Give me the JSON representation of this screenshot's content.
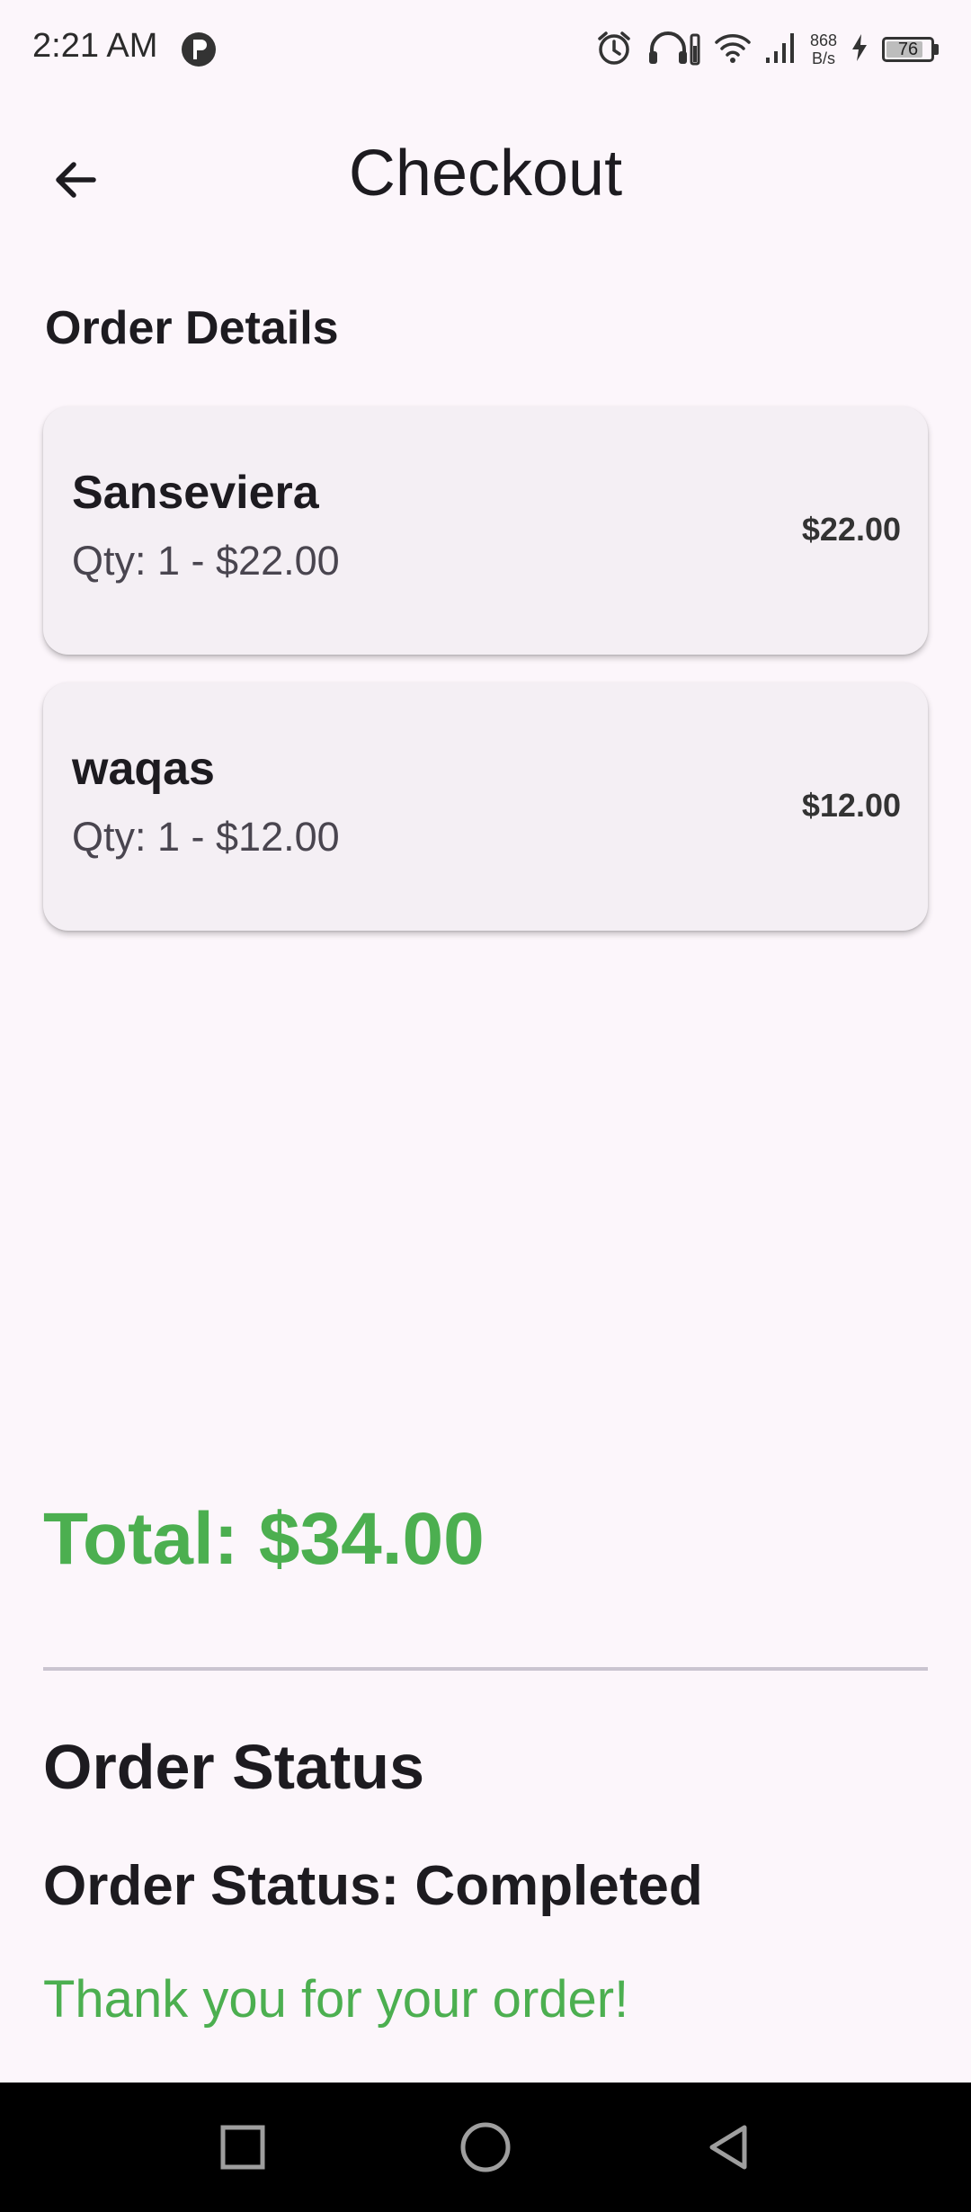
{
  "status_bar": {
    "time": "2:21 AM",
    "net_speed_value": "868",
    "net_speed_unit": "B/s",
    "battery_level": "76",
    "icons": [
      "app-notification-icon",
      "alarm-icon",
      "headphones-icon",
      "wifi-icon",
      "signal-icon",
      "charging-icon",
      "battery-icon"
    ]
  },
  "app_bar": {
    "title": "Checkout",
    "back_icon": "arrow-back-icon"
  },
  "order_details": {
    "heading": "Order Details",
    "items": [
      {
        "name": "Sanseviera",
        "subtitle": "Qty: 1 - $22.00",
        "price": "$22.00"
      },
      {
        "name": "waqas",
        "subtitle": "Qty: 1 - $12.00",
        "price": "$12.00"
      }
    ]
  },
  "total": {
    "text": "Total: $34.00"
  },
  "order_status": {
    "heading": "Order Status",
    "status_line": "Order Status: Completed",
    "thanks": "Thank you for your order!"
  },
  "navigation": {
    "icons": [
      "recent-apps-icon",
      "home-icon",
      "back-icon"
    ]
  },
  "colors": {
    "background": "#fcf6fb",
    "card": "#f4eff4",
    "accent_green": "#4caf50",
    "text_primary": "#1d1b20",
    "nav_bar": "#000000"
  }
}
